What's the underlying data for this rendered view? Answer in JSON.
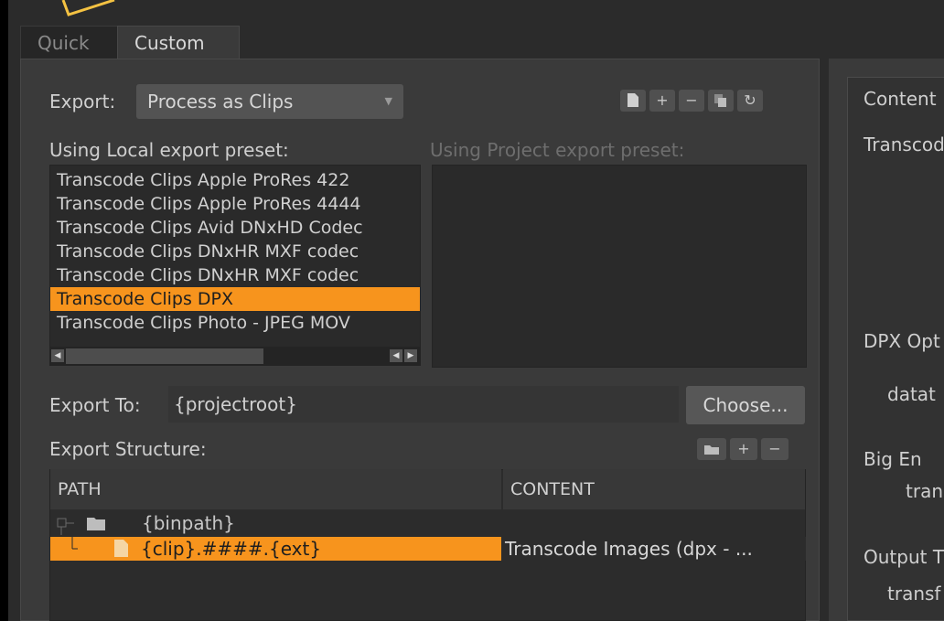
{
  "tabs": {
    "quick": "Quick",
    "custom": "Custom"
  },
  "export": {
    "label": "Export:",
    "selected": "Process as Clips"
  },
  "toolbar_icons": [
    "file-icon",
    "plus-icon",
    "minus-icon",
    "copy-icon",
    "refresh-icon"
  ],
  "presets": {
    "local_label": "Using Local export preset:",
    "project_label": "Using Project export preset:",
    "local_items": [
      "Transcode Clips Apple ProRes 422",
      "Transcode Clips Apple ProRes 4444",
      "Transcode Clips Avid DNxHD Codec",
      "Transcode Clips DNxHR MXF codec",
      "Transcode Clips DNxHR MXF codec",
      "Transcode Clips DPX",
      "Transcode Clips Photo - JPEG MOV"
    ],
    "selected_index": 5
  },
  "export_to": {
    "label": "Export To:",
    "value": "{projectroot}",
    "choose": "Choose..."
  },
  "structure": {
    "label": "Export Structure:",
    "columns": {
      "path": "PATH",
      "content": "CONTENT"
    },
    "rows": [
      {
        "path": "{binpath}",
        "content": ""
      },
      {
        "path": "{clip}.####.{ext}",
        "content": "Transcode Images (dpx - ..."
      }
    ]
  },
  "right_panel": {
    "tab": "Content",
    "labels": [
      "Transcode",
      "DPX Opt",
      "datat",
      "Big En",
      "tran",
      "Output T",
      "transf"
    ]
  },
  "colors": {
    "accent": "#f7941d",
    "panel": "#3a3a3a",
    "list_bg": "#2a2a2a"
  }
}
